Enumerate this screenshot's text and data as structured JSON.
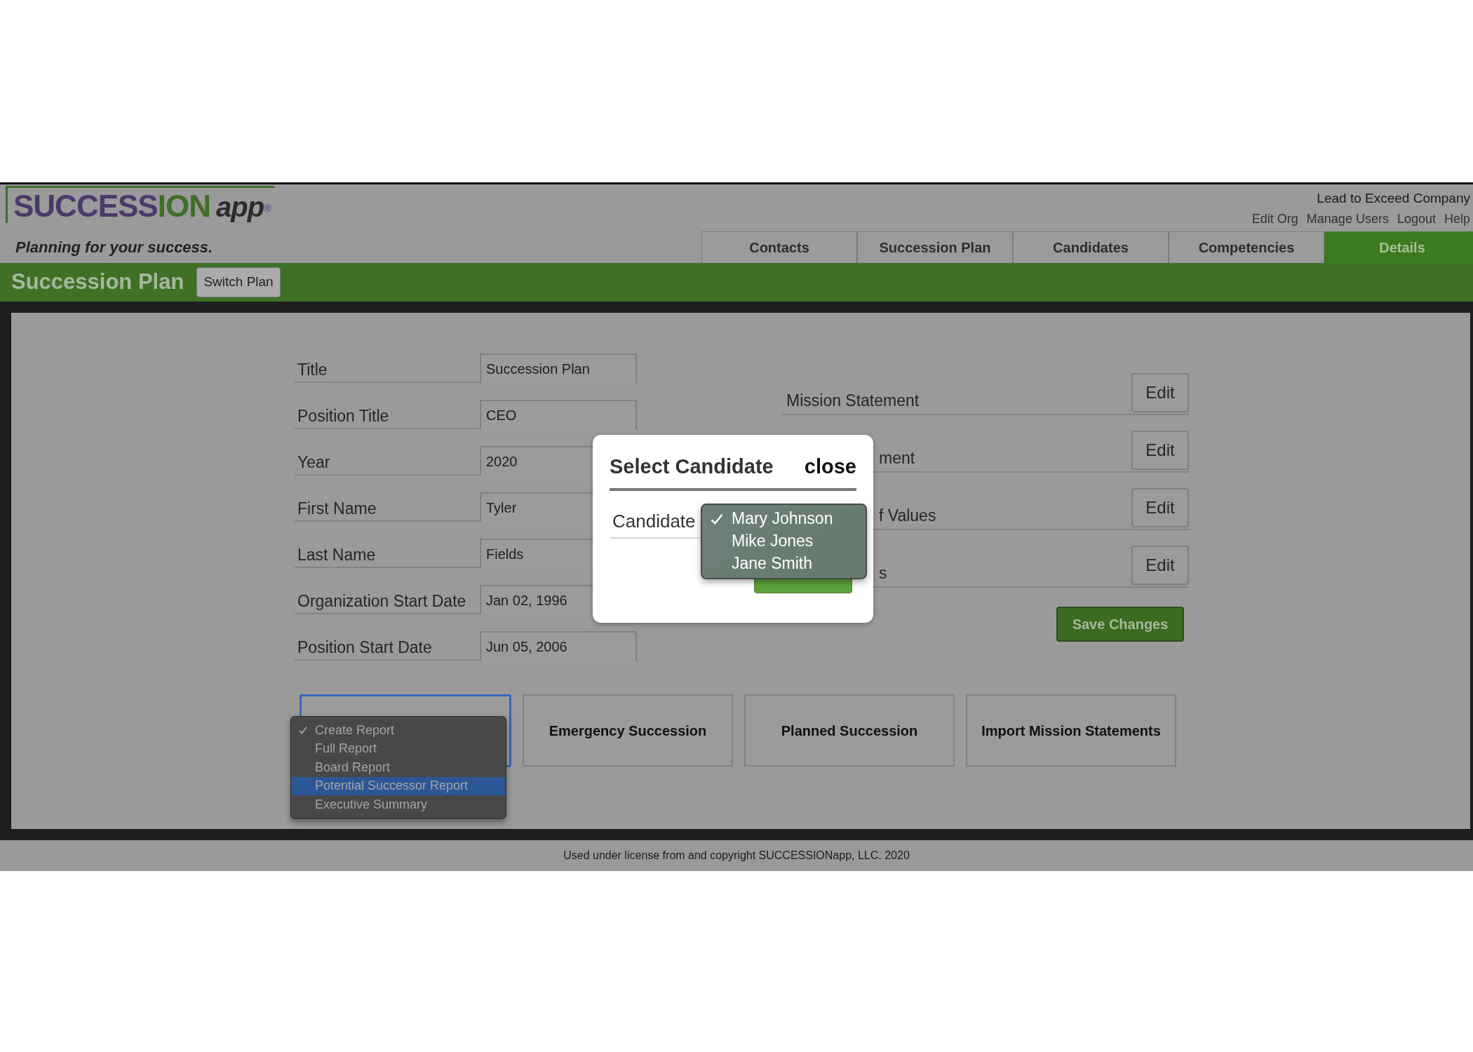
{
  "header": {
    "logo": {
      "brand_main": "SUCCESS",
      "brand_accent": "ION",
      "brand_suffix": "app",
      "registered": "®",
      "tagline": "Planning for your success."
    },
    "company": "Lead to Exceed Company",
    "links": [
      "Edit Org",
      "Manage Users",
      "Logout",
      "Help"
    ],
    "tabs": [
      {
        "label": "Contacts",
        "selected": false
      },
      {
        "label": "Succession Plan",
        "selected": false
      },
      {
        "label": "Candidates",
        "selected": false
      },
      {
        "label": "Competencies",
        "selected": false
      },
      {
        "label": "Details",
        "selected": true
      }
    ]
  },
  "page_bar": {
    "title": "Succession Plan",
    "button": "Switch Plan"
  },
  "form": {
    "fields": [
      {
        "label": "Title",
        "value": "Succession Plan"
      },
      {
        "label": "Position Title",
        "value": "CEO"
      },
      {
        "label": "Year",
        "value": "2020"
      },
      {
        "label": "First Name",
        "value": "Tyler"
      },
      {
        "label": "Last Name",
        "value": "Fields"
      },
      {
        "label": "Organization Start Date",
        "value": "Jan 02, 1996"
      },
      {
        "label": "Position Start Date",
        "value": "Jun 05, 2006"
      }
    ]
  },
  "statements": [
    {
      "label": "Mission Statement",
      "button": "Edit",
      "partly_hidden": false
    },
    {
      "label": "ment",
      "button": "Edit",
      "partly_hidden": true
    },
    {
      "label": "f Values",
      "button": "Edit",
      "partly_hidden": true
    },
    {
      "label": "s",
      "button": "Edit",
      "partly_hidden": true
    }
  ],
  "save_button": "Save Changes",
  "actions": {
    "report_select": {
      "focused": true,
      "options": [
        {
          "label": "Create Report",
          "checked": true,
          "selected": false
        },
        {
          "label": "Full Report",
          "checked": false,
          "selected": false
        },
        {
          "label": "Board Report",
          "checked": false,
          "selected": false
        },
        {
          "label": "Potential Successor Report",
          "checked": false,
          "selected": true
        },
        {
          "label": "Executive Summary",
          "checked": false,
          "selected": false
        }
      ]
    },
    "buttons": [
      "Emergency Succession",
      "Planned Succession",
      "Import Mission Statements"
    ]
  },
  "footer": "Used under license from and copyright SUCCESSIONapp, LLC. 2020",
  "modal": {
    "title": "Select Candidate",
    "close": "close",
    "field_label": "Candidate",
    "options": [
      {
        "label": "Mary Johnson",
        "checked": true
      },
      {
        "label": "Mike Jones",
        "checked": false
      },
      {
        "label": "Jane Smith",
        "checked": false
      }
    ]
  }
}
